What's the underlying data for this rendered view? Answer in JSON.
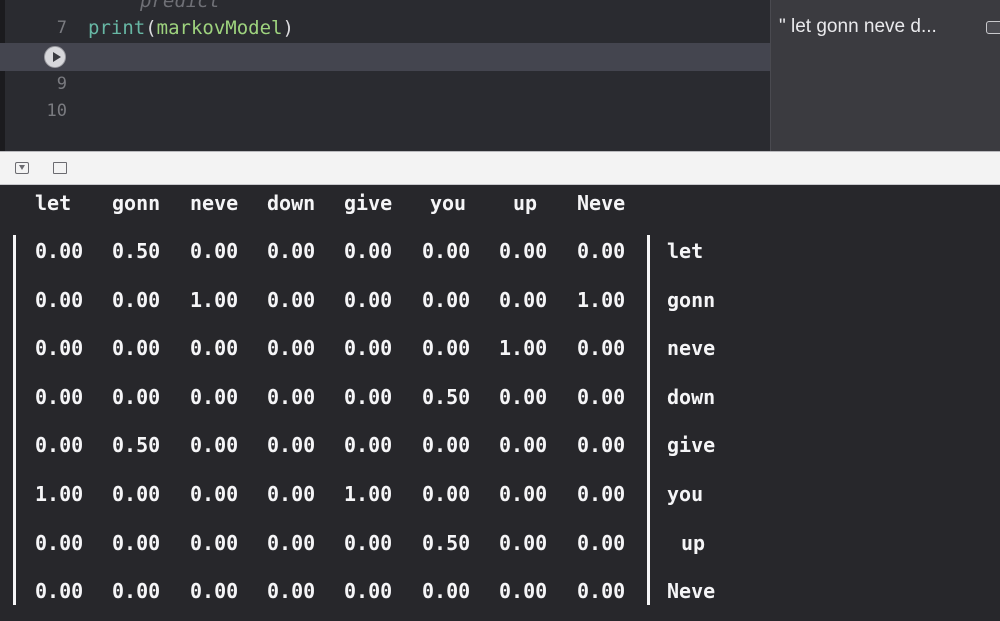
{
  "editor": {
    "ghost_text": "predict",
    "lines": [
      {
        "num": "7",
        "fn": "print",
        "open": "(",
        "arg": "markovModel",
        "close": ")"
      },
      {
        "num": "",
        "run": true
      },
      {
        "num": "9"
      },
      {
        "num": "10"
      }
    ]
  },
  "results": {
    "preview": "\" let  gonn  neve  d..."
  },
  "console": {
    "columns": [
      "let",
      "gonn",
      "neve",
      "down",
      "give",
      "you",
      "up",
      "Neve"
    ],
    "rows": [
      {
        "label": "let",
        "values": [
          "0.00",
          "0.50",
          "0.00",
          "0.00",
          "0.00",
          "0.00",
          "0.00",
          "0.00"
        ]
      },
      {
        "label": "gonn",
        "values": [
          "0.00",
          "0.00",
          "1.00",
          "0.00",
          "0.00",
          "0.00",
          "0.00",
          "1.00"
        ]
      },
      {
        "label": "neve",
        "values": [
          "0.00",
          "0.00",
          "0.00",
          "0.00",
          "0.00",
          "0.00",
          "1.00",
          "0.00"
        ]
      },
      {
        "label": "down",
        "values": [
          "0.00",
          "0.00",
          "0.00",
          "0.00",
          "0.00",
          "0.50",
          "0.00",
          "0.00"
        ]
      },
      {
        "label": "give",
        "values": [
          "0.00",
          "0.50",
          "0.00",
          "0.00",
          "0.00",
          "0.00",
          "0.00",
          "0.00"
        ]
      },
      {
        "label": "you",
        "values": [
          "1.00",
          "0.00",
          "0.00",
          "0.00",
          "1.00",
          "0.00",
          "0.00",
          "0.00"
        ]
      },
      {
        "label": "up",
        "values": [
          "0.00",
          "0.00",
          "0.00",
          "0.00",
          "0.00",
          "0.50",
          "0.00",
          "0.00"
        ]
      },
      {
        "label": "Neve",
        "values": [
          "0.00",
          "0.00",
          "0.00",
          "0.00",
          "0.00",
          "0.00",
          "0.00",
          "0.00"
        ]
      }
    ]
  }
}
